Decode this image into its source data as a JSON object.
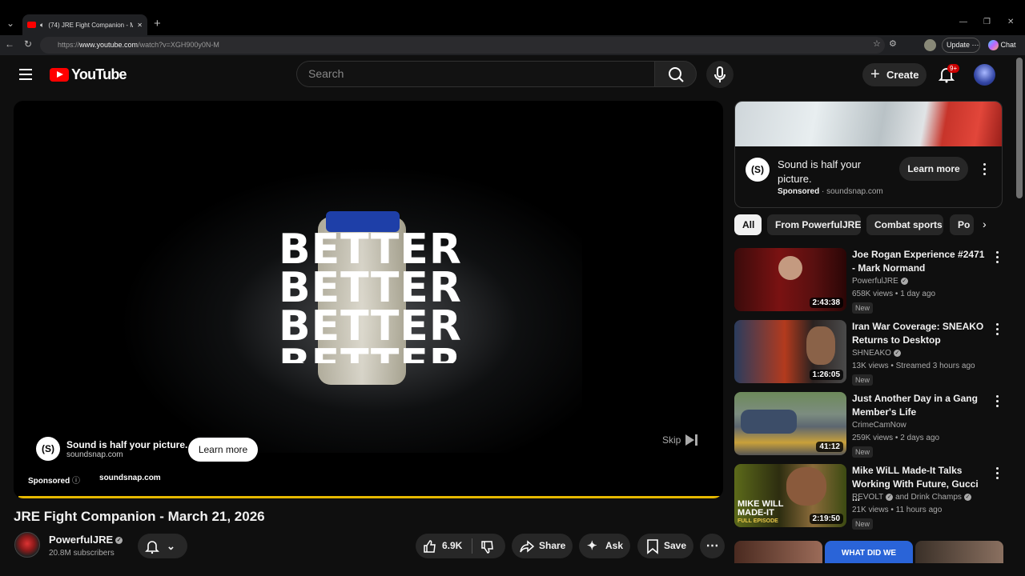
{
  "browser": {
    "tab_title": "(74) JRE Fight Companion - M",
    "url_prefix": "https://",
    "url_host": "www.youtube.com",
    "url_path": "/watch?v=XGH900y0N-M",
    "update_label": "Update",
    "chat_label": "Chat"
  },
  "header": {
    "logo_text": "YouTube",
    "search_placeholder": "Search",
    "create_label": "Create",
    "notif_badge": "9+"
  },
  "player": {
    "overlay_words": [
      "BETTER",
      "BETTER",
      "BETTER",
      "BETTER"
    ],
    "ad_icon": "(S)",
    "ad_title": "Sound is half your picture.",
    "ad_domain": "soundsnap.com",
    "learn_more": "Learn more",
    "skip_label": "Skip",
    "sponsored_label": "Sponsored",
    "sponsored_domain": "soundsnap.com",
    "progress": 1.0
  },
  "video": {
    "title": "JRE Fight Companion - March 21, 2026",
    "channel": "PowerfulJRE",
    "subscribers": "20.8M subscribers",
    "likes": "6.9K",
    "share_label": "Share",
    "ask_label": "Ask",
    "save_label": "Save"
  },
  "side_ad": {
    "icon": "(S)",
    "title": "Sound is half your picture.",
    "sponsored": "Sponsored",
    "domain": "· soundsnap.com",
    "learn_more": "Learn more"
  },
  "chips": [
    "All",
    "From PowerfulJRE",
    "Combat sports",
    "Po"
  ],
  "recommendations": [
    {
      "title": "Joe Rogan Experience #2471 - Mark Normand",
      "channel": "PowerfulJRE",
      "meta": "658K views • 1 day ago",
      "duration": "2:43:38",
      "badge": "New"
    },
    {
      "title": "Iran War Coverage: SNEAKO Returns to Desktop",
      "channel": "SHNEAKO",
      "meta": "13K views • Streamed 3 hours ago",
      "duration": "1:26:05",
      "badge": "New"
    },
    {
      "title": "Just Another Day in a Gang Member's Life",
      "channel": "CrimeCamNow",
      "meta": "259K views • 2 days ago",
      "duration": "41:12",
      "badge": "New"
    },
    {
      "title": "Mike WiLL Made-It Talks Working With Future, Gucci ...",
      "channel": "REVOLT",
      "channel_extra": "and Drink Champs",
      "meta": "21K views • 11 hours ago",
      "duration": "2:19:50",
      "badge": "New",
      "thumb_text": "MIKE WILL MADE-IT",
      "thumb_sub": "FULL EPISODE"
    }
  ],
  "partial_thumb_text": "WHAT DID WE"
}
